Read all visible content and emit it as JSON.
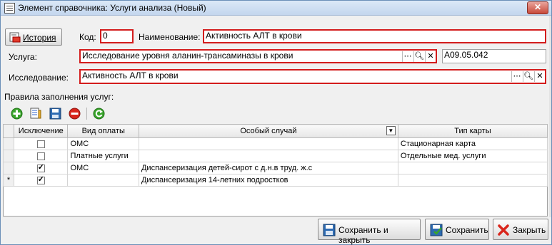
{
  "window": {
    "title": "Элемент справочника: Услуги анализа (Новый)",
    "close_label": "✕"
  },
  "toolbar": {
    "history_label": "История"
  },
  "form": {
    "code_label": "Код:",
    "code_value": "0",
    "name_label": "Наименование:",
    "name_value": "Активность АЛТ в крови",
    "service_label": "Услуга:",
    "service_value": "Исследование уровня аланин-трансаминазы в крови",
    "service_code": "A09.05.042",
    "study_label": "Исследование:",
    "study_value": "Активность АЛТ в крови"
  },
  "rules": {
    "section_label": "Правила заполнения услуг:",
    "columns": [
      "Исключение",
      "Вид оплаты",
      "Особый случай",
      "Тип карты"
    ],
    "rows": [
      {
        "marker": "",
        "exclusion": false,
        "payment": "ОМС",
        "special": "",
        "card_type": "Стационарная карта"
      },
      {
        "marker": "",
        "exclusion": false,
        "payment": "Платные услуги",
        "special": "",
        "card_type": "Отдельные мед. услуги"
      },
      {
        "marker": "",
        "exclusion": true,
        "payment": "ОМС",
        "special": "Диспансеризация детей-сирот с д.н.в труд. ж.с",
        "card_type": ""
      },
      {
        "marker": "*",
        "exclusion": true,
        "payment": "",
        "special": "Диспансеризация 14-летних подростков",
        "card_type": ""
      }
    ]
  },
  "footer": {
    "save_close_label": "Сохранить и закрыть",
    "save_label": "Сохранить",
    "close_label": "Закрыть"
  },
  "colors": {
    "required_border": "#d31c1c",
    "title_bar": "#c3d6ee"
  }
}
